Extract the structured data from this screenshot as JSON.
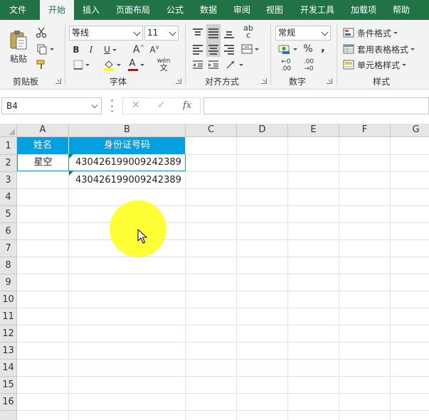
{
  "menu": {
    "tabs": [
      {
        "label": "文件",
        "active": false
      },
      {
        "label": "开始",
        "active": true
      },
      {
        "label": "插入",
        "active": false
      },
      {
        "label": "页面布局",
        "active": false
      },
      {
        "label": "公式",
        "active": false
      },
      {
        "label": "数据",
        "active": false
      },
      {
        "label": "审阅",
        "active": false
      },
      {
        "label": "视图",
        "active": false
      },
      {
        "label": "开发工具",
        "active": false
      },
      {
        "label": "加载项",
        "active": false
      },
      {
        "label": "帮助",
        "active": false
      }
    ]
  },
  "ribbon": {
    "clipboard": {
      "label": "剪贴板",
      "paste_label": "粘贴"
    },
    "font": {
      "label": "字体",
      "font_name": "等线",
      "font_size": "11",
      "bold": "B",
      "italic": "I",
      "underline": "U",
      "grow": "A",
      "shrink": "A",
      "font_color_letter": "A",
      "phonetic_top": "wén",
      "phonetic_bottom": "文"
    },
    "alignment": {
      "label": "对齐方式",
      "orientation": "ab",
      "orientation_sub": "c"
    },
    "number": {
      "label": "数字",
      "format": "常规",
      "percent": "%",
      "comma": ",",
      "inc_decimal_top": "←0",
      "inc_decimal_bottom": ".00",
      "dec_decimal_top": ".00",
      "dec_decimal_bottom": "→0"
    },
    "styles": {
      "label": "样式",
      "conditional": "条件格式",
      "table_format": "套用表格格式",
      "cell_styles": "单元格样式"
    }
  },
  "formula_bar": {
    "name_box": "B4",
    "cancel": "✕",
    "enter": "✓",
    "fx": "fx",
    "formula": ""
  },
  "sheet": {
    "columns": [
      "A",
      "B",
      "C",
      "D",
      "E",
      "F",
      "G"
    ],
    "rows": [
      "1",
      "2",
      "3",
      "4",
      "5",
      "6",
      "7",
      "8",
      "9",
      "10",
      "11",
      "12",
      "13",
      "14",
      "15",
      "16"
    ],
    "cells": {
      "A1": "姓名",
      "B1": "身份证号码",
      "A2": "星空",
      "B2": "430426199009242389",
      "B3": "430426199009242389"
    },
    "header_fill": "#00a0e3"
  },
  "colors": {
    "tab_bar": "#217346",
    "ribbon": "#f3f3f3",
    "halo": "#ffff1a",
    "error_marker": "#1e7a3e"
  }
}
